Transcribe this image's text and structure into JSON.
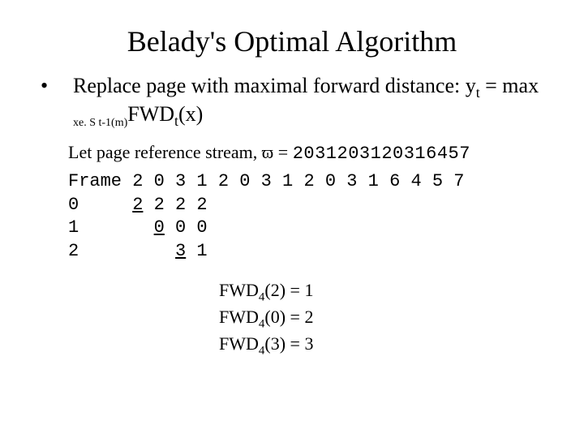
{
  "title": "Belady's Optimal Algorithm",
  "bullet": {
    "lead": "Replace page with maximal forward distance: ",
    "eq_lhs": "y",
    "eq_lhs_sub": "t",
    "eq_mid": " = max ",
    "eq_sub_expr": "xe. S t-1(m)",
    "eq_rhs": "FWD",
    "eq_rhs_sub": "t",
    "eq_rhs_tail": "(x)"
  },
  "stream": {
    "prefix": "Let page reference stream, ",
    "symbol": "ϖ",
    "equals": " = ",
    "value": "2031203120316457"
  },
  "trace": {
    "header_label": "Frame",
    "refs": [
      "2",
      "0",
      "3",
      "1",
      "2",
      "0",
      "3",
      "1",
      "2",
      "0",
      "3",
      "1",
      "6",
      "4",
      "5",
      "7"
    ],
    "rows": [
      {
        "label": "0",
        "cells": [
          "2",
          "2",
          "2",
          "2"
        ],
        "new_index": 0
      },
      {
        "label": "1",
        "cells": [
          "",
          "0",
          "0",
          "0"
        ],
        "new_index": 1
      },
      {
        "label": "2",
        "cells": [
          "",
          "",
          "3",
          "1"
        ],
        "new_index": 2
      }
    ]
  },
  "fwd": [
    {
      "name": "FWD",
      "sub": "4",
      "arg": "(2)",
      "eq": " = ",
      "val": "1"
    },
    {
      "name": "FWD",
      "sub": "4",
      "arg": "(0)",
      "eq": " = ",
      "val": "2"
    },
    {
      "name": "FWD",
      "sub": "4",
      "arg": "(3)",
      "eq": " = ",
      "val": "3"
    }
  ]
}
